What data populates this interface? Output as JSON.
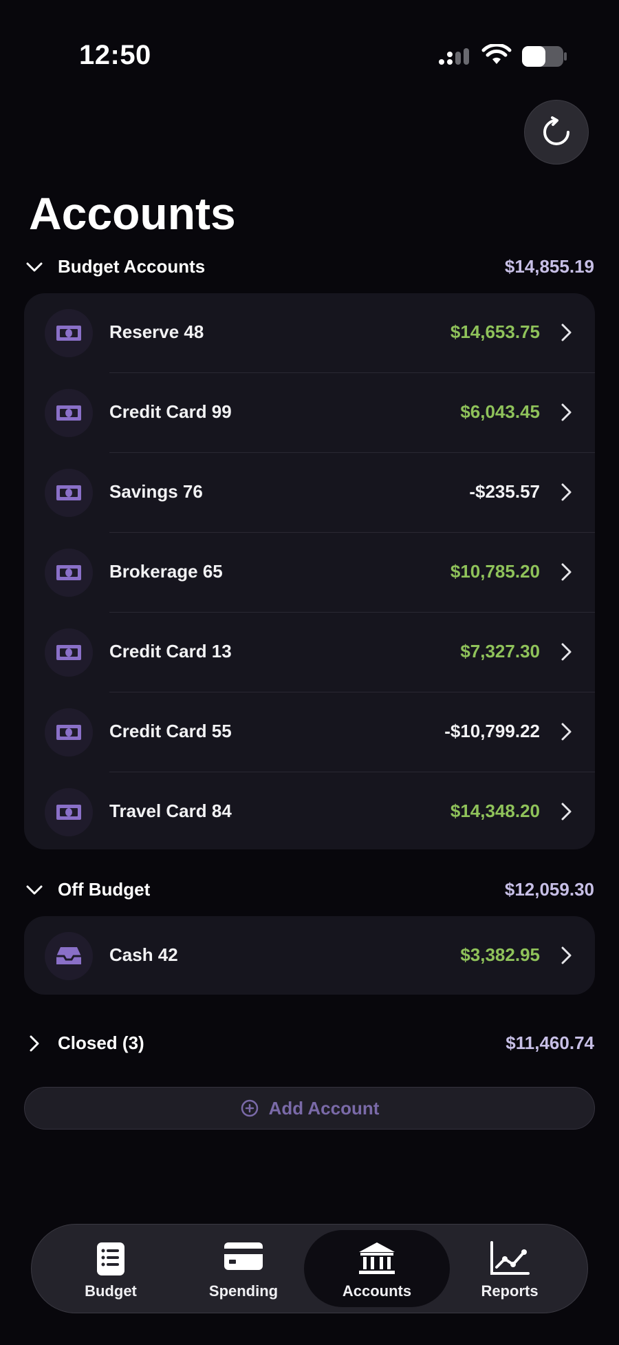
{
  "status": {
    "time": "12:50"
  },
  "title": "Accounts",
  "budget_section": {
    "label": "Budget Accounts",
    "total": "$14,855.19",
    "accounts": [
      {
        "name": "Reserve 48",
        "amount": "$14,653.75",
        "sign": "pos"
      },
      {
        "name": "Credit Card 99",
        "amount": "$6,043.45",
        "sign": "pos"
      },
      {
        "name": "Savings 76",
        "amount": "-$235.57",
        "sign": "neg"
      },
      {
        "name": "Brokerage 65",
        "amount": "$10,785.20",
        "sign": "pos"
      },
      {
        "name": "Credit Card 13",
        "amount": "$7,327.30",
        "sign": "pos"
      },
      {
        "name": "Credit Card 55",
        "amount": "-$10,799.22",
        "sign": "neg"
      },
      {
        "name": "Travel Card 84",
        "amount": "$14,348.20",
        "sign": "pos"
      }
    ]
  },
  "offbudget_section": {
    "label": "Off Budget",
    "total": "$12,059.30",
    "accounts": [
      {
        "name": "Cash 42",
        "amount": "$3,382.95",
        "sign": "pos"
      }
    ]
  },
  "closed_section": {
    "label": "Closed (3)",
    "total": "$11,460.74"
  },
  "add_account": {
    "label": "Add Account"
  },
  "tabs": [
    {
      "label": "Budget",
      "icon": "list-icon"
    },
    {
      "label": "Spending",
      "icon": "credit-card-icon"
    },
    {
      "label": "Accounts",
      "icon": "bank-icon"
    },
    {
      "label": "Reports",
      "icon": "line-chart-icon"
    }
  ],
  "colors": {
    "positive": "#8fc25a",
    "accent": "#7a6aa8",
    "background": "#08070c",
    "card": "#16151e"
  }
}
